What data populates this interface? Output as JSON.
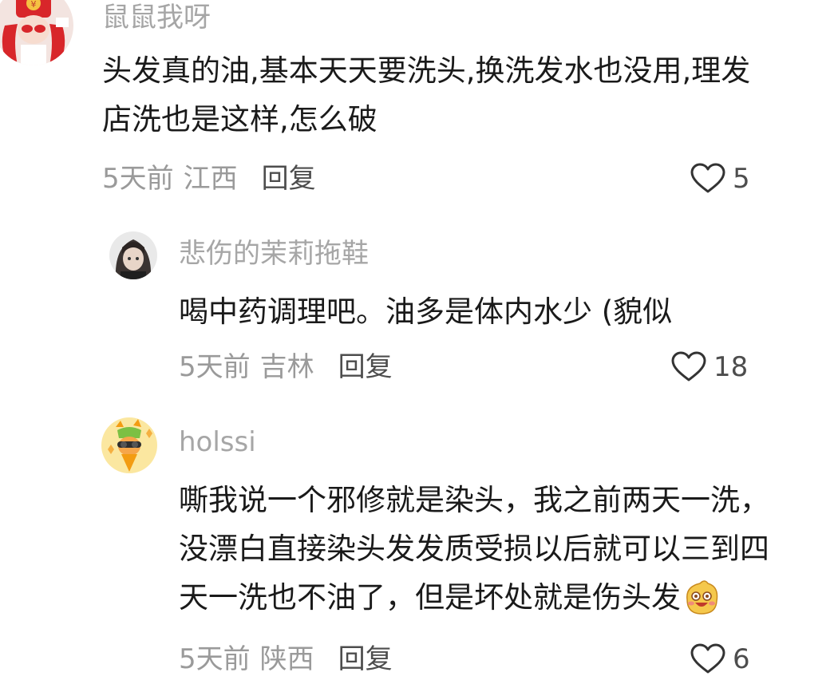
{
  "comments": [
    {
      "avatar": "red-hat-girl-avatar",
      "username": "鼠鼠我呀",
      "lines": [
        "头发真的油,基本天天要洗头,换洗发水也没用,理发",
        "店洗也是这样,怎么破"
      ],
      "time": "5天前",
      "location": "江西",
      "reply_label": "回复",
      "likes": "5"
    },
    {
      "avatar": "dark-hair-girl-avatar",
      "username": "悲伤的茉莉拖鞋",
      "lines": [
        "喝中药调理吧。油多是体内水少 (貌似"
      ],
      "time": "5天前",
      "location": "吉林",
      "reply_label": "回复",
      "likes": "18"
    },
    {
      "avatar": "carrot-cartoon-avatar",
      "username": "holssi",
      "lines": [
        "嘶我说一个邪修就是染头，我之前两天一洗，",
        "没漂白直接染头发发质受损以后就可以三到四",
        "天一洗也不油了，但是坏处就是伤头发"
      ],
      "time": "5天前",
      "location": "陕西",
      "reply_label": "回复",
      "likes": "6",
      "trailing_emoji": "grinning-blush-emoji"
    }
  ],
  "colors": {
    "username": "#a6a6a6",
    "body": "#1a1a1a",
    "meta": "#9a9a9a",
    "reply": "#4d4d4d",
    "heart": "#333333"
  }
}
